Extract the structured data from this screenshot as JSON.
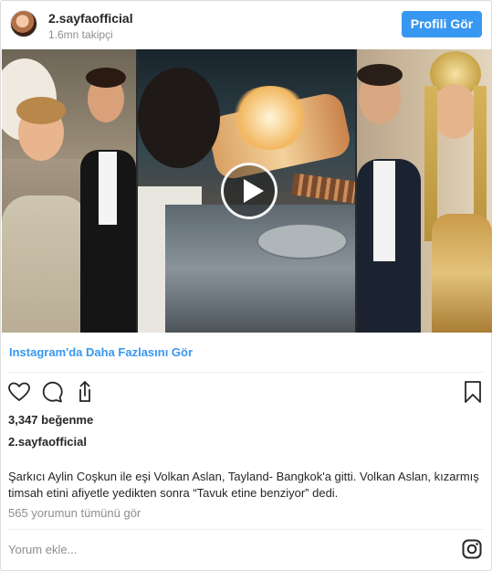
{
  "header": {
    "username": "2.sayfaofficial",
    "followers": "1.6mn takipçi",
    "profile_button": "Profili Gör"
  },
  "media": {
    "type": "video",
    "play_icon": "play-icon"
  },
  "more_link": "Instagram'da Daha Fazlasını Gör",
  "actions": {
    "icons": [
      "heart-icon",
      "comment-icon",
      "share-icon",
      "bookmark-icon"
    ]
  },
  "likes": "3,347 beğenme",
  "owner": "2.sayfaofficial",
  "caption": "Şarkıcı Aylin Coşkun ile eşi Volkan Aslan, Tayland- Bangkok'a gitti. Volkan Aslan, kızarmış timsah etini afiyetle yedikten sonra “Tavuk etine benziyor” dedi.",
  "comments_link": "565 yorumun tümünü gör",
  "comment_input": {
    "placeholder": "Yorum ekle...",
    "value": ""
  },
  "colors": {
    "accent": "#3897f0",
    "muted": "#8e8e8e",
    "text": "#262626",
    "border": "#dbdbdb"
  }
}
